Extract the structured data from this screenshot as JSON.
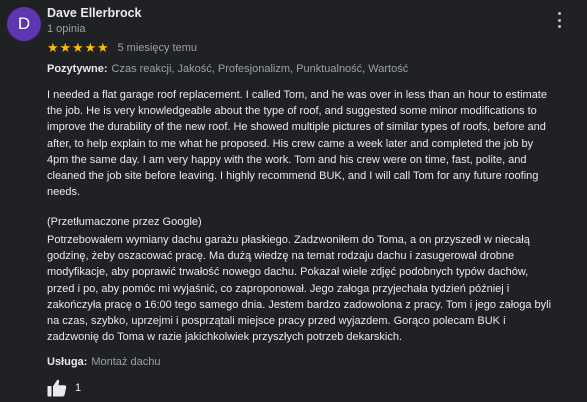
{
  "reviewer": {
    "initial": "D",
    "name": "Dave Ellerbrock",
    "reviews_count": "1 opinia",
    "avatar_color": "#5e35b1"
  },
  "rating": {
    "stars": 5,
    "max": 5,
    "star_color": "#fbbc04",
    "time_ago": "5 miesięcy temu"
  },
  "attributes": {
    "label": "Pozytywne:",
    "value": "Czas reakcji, Jakość, Profesjonalizm, Punktualność, Wartość"
  },
  "review_text": "I needed a flat garage roof replacement. I called Tom, and he was over in less than an hour to estimate\nthe job. He is very knowledgeable about the type of roof, and suggested some minor modifications to\nimprove the durability of the new roof. He showed multiple pictures of similar types of roofs, before and\nafter, to help explain to me what he proposed. His crew came a week later and completed the job by\n4pm the same day. I am very happy with the work. Tom and his crew were on time, fast, polite, and\ncleaned the job site before leaving. I highly recommend BUK, and I will call Tom for any future roofing\nneeds.",
  "translation_label": "(Przetłumaczone przez Google)",
  "review_text_translated": "Potrzebowałem wymiany dachu garażu płaskiego. Zadzwoniłem do Toma, a on przyszedł w niecałą\ngodzinę, żeby oszacować pracę. Ma dużą wiedzę na temat rodzaju dachu i zasugerował drobne\nmodyfikacje, aby poprawić trwałość nowego dachu. Pokazał wiele zdjęć podobnych typów dachów,\nprzed i po, aby pomóc mi wyjaśnić, co zaproponował. Jego załoga przyjechała tydzień później i\nzakończyła pracę o 16:00 tego samego dnia. Jestem bardzo zadowolona z pracy. Tom i jego załoga byli\nna czas, szybko, uprzejmi i posprzątali miejsce pracy przed wyjazdem. Gorąco polecam BUK i\nzadzwonię do Toma w razie jakichkolwiek przyszłych potrzeb dekarskich.",
  "service": {
    "label": "Usługa:",
    "value": "Montaż dachu"
  },
  "likes": {
    "count": "1",
    "icon": "thumbs-up-icon"
  },
  "menu_icon": "more-vert-icon"
}
